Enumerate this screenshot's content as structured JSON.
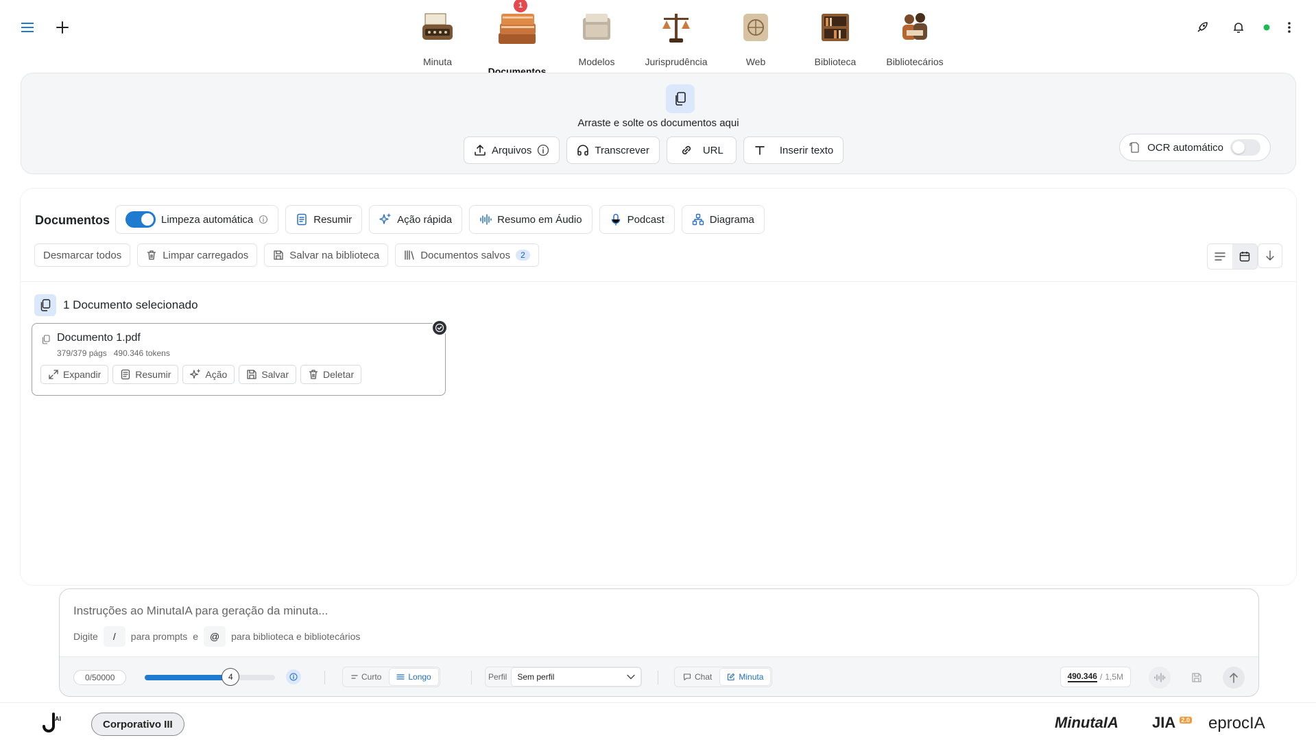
{
  "nav": {
    "items": [
      {
        "label": "Minuta"
      },
      {
        "label": "Documentos",
        "badge": "1"
      },
      {
        "label": "Modelos"
      },
      {
        "label": "Jurisprudência"
      },
      {
        "label": "Web"
      },
      {
        "label": "Biblioteca"
      },
      {
        "label": "Bibliotecários"
      }
    ],
    "status_color": "#1db954"
  },
  "upload": {
    "hint": "Arraste e solte os documentos aqui",
    "buttons": {
      "arquivos": "Arquivos",
      "transcrever": "Transcrever",
      "url": "URL",
      "inserir_texto": "Inserir texto"
    },
    "ocr_label": "OCR automático",
    "ocr_enabled": false
  },
  "docs": {
    "title": "Documentos",
    "limpeza_label": "Limpeza automática",
    "limpeza_enabled": true,
    "actions": {
      "resumir": "Resumir",
      "acao_rapida": "Ação rápida",
      "resumo_audio": "Resumo em Áudio",
      "podcast": "Podcast",
      "diagrama": "Diagrama"
    },
    "secondary": {
      "desmarcar": "Desmarcar todos",
      "limpar": "Limpar carregados",
      "salvar": "Salvar na biblioteca",
      "salvos": "Documentos salvos",
      "salvos_count": "2"
    },
    "selected_heading": "1 Documento selecionado",
    "card": {
      "name": "Documento 1.pdf",
      "pages": "379/379 págs",
      "tokens": "490.346 tokens",
      "actions": {
        "expandir": "Expandir",
        "resumir": "Resumir",
        "acao": "Ação",
        "salvar": "Salvar",
        "deletar": "Deletar"
      }
    }
  },
  "composer": {
    "placeholder": "Instruções ao MinutaIA para geração da minuta...",
    "tip_digite": "Digite",
    "tip_slash": "/",
    "tip_prompts": "para prompts",
    "tip_e": "e",
    "tip_at": "@",
    "tip_biblioteca": "para biblioteca e bibliotecários",
    "char_count": "0/50000",
    "slider_value": "4",
    "slider_fraction": 0.66,
    "length": {
      "curto": "Curto",
      "longo": "Longo",
      "selected": "Longo"
    },
    "perfil_label": "Perfil",
    "perfil_value": "Sem perfil",
    "mode": {
      "chat": "Chat",
      "minuta": "Minuta",
      "selected": "Minuta"
    },
    "tokens_used": "490.346",
    "tokens_sep": "/",
    "tokens_max": "1,5M"
  },
  "footer": {
    "plan": "Corporativo III",
    "brands": [
      "MinutaIA",
      "JIA",
      "eprocIA"
    ],
    "jia_badge": "2.0"
  },
  "colors": {
    "accent": "#1f7bd0",
    "badge": "#e5484d",
    "soft_blue": "#dbe7fb"
  }
}
